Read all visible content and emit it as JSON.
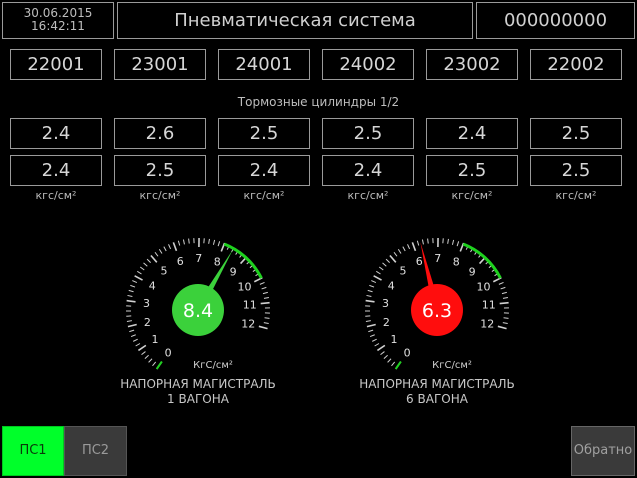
{
  "header": {
    "date": "30.06.2015",
    "time": "16:42:11",
    "title": "Пневматическая система",
    "train_number": "000000000"
  },
  "car_numbers": [
    "22001",
    "23001",
    "24001",
    "24002",
    "23002",
    "22002"
  ],
  "brake_cylinders": {
    "title": "Тормозные цилиндры 1/2",
    "row1": [
      "2.4",
      "2.6",
      "2.5",
      "2.5",
      "2.4",
      "2.5"
    ],
    "row2": [
      "2.4",
      "2.5",
      "2.4",
      "2.4",
      "2.5",
      "2.5"
    ],
    "unit": "кгс/см²"
  },
  "gauges": [
    {
      "value": 8.4,
      "value_text": "8.4",
      "unit": "КгС/см²",
      "label_line1": "НАПОРНАЯ МАГИСТРАЛЬ",
      "label_line2": "1 ВАГОНА",
      "min": 0,
      "max": 12,
      "ticks": [
        "0",
        "1",
        "2",
        "3",
        "4",
        "5",
        "6",
        "7",
        "8",
        "9",
        "10",
        "11",
        "12"
      ],
      "green_zone": [
        8,
        10
      ],
      "color": "#3bd13b"
    },
    {
      "value": 6.3,
      "value_text": "6.3",
      "unit": "КгС/см²",
      "label_line1": "НАПОРНАЯ МАГИСТРАЛЬ",
      "label_line2": "6 ВАГОНА",
      "min": 0,
      "max": 12,
      "ticks": [
        "0",
        "1",
        "2",
        "3",
        "4",
        "5",
        "6",
        "7",
        "8",
        "9",
        "10",
        "11",
        "12"
      ],
      "green_zone": [
        8,
        10
      ],
      "color": "#ff0d0d"
    }
  ],
  "buttons": {
    "ps1": "ПС1",
    "ps2": "ПС2",
    "back": "Обратно"
  }
}
